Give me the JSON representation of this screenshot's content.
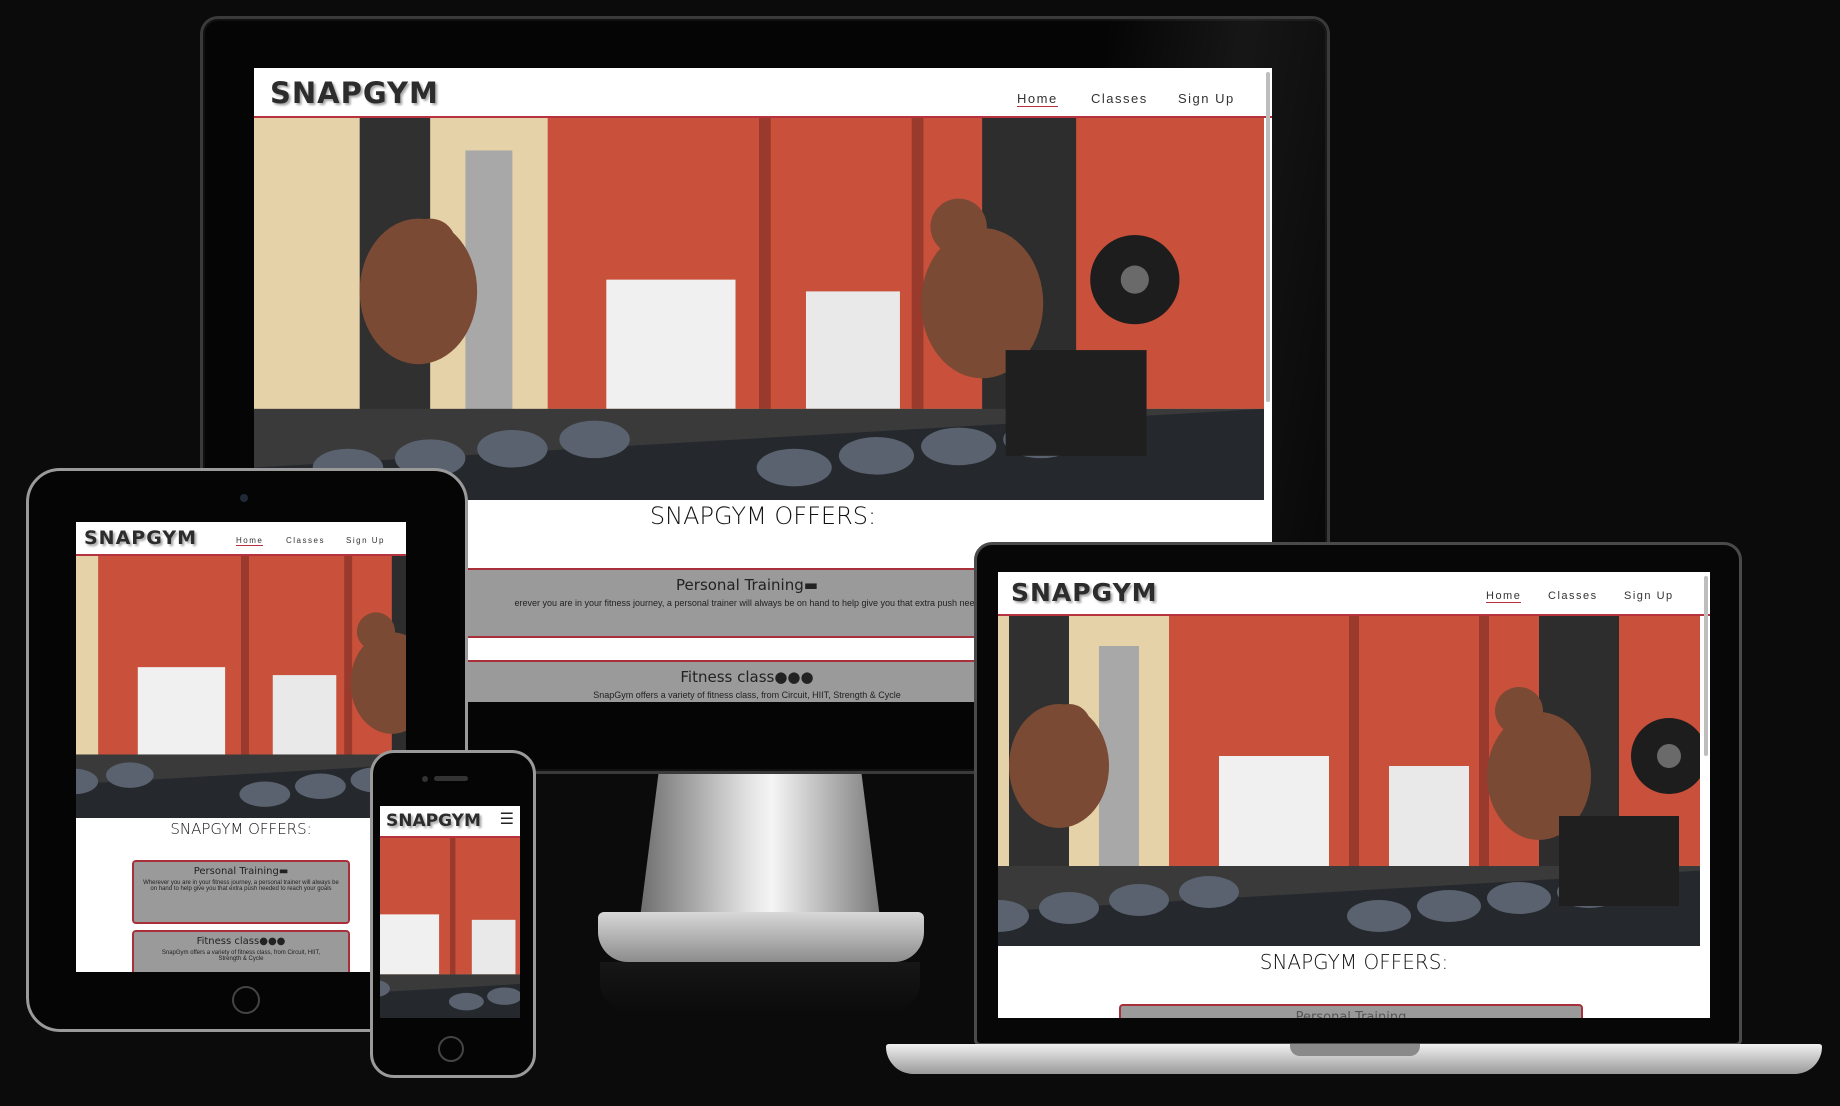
{
  "site": {
    "brand": "SNAPGYM"
  },
  "nav": {
    "home": "Home",
    "classes": "Classes",
    "signup": "Sign Up"
  },
  "offers": {
    "title": "SNAPGYM OFFERS:",
    "cards": [
      {
        "title": "Personal Training",
        "icon": "dumbbell-icon",
        "text": "Wherever you are in your fitness journey, a personal trainer will always be on hand to help give you that extra push needed to reach your goals"
      },
      {
        "title": "Fitness class",
        "icon": "people-group-icon",
        "text": "SnapGym offers a variety of fitness class, from Circuit, HIIT, Strength & Cycle"
      }
    ],
    "desktop_card1_text": "erever you are in your fitness journey, a personal trainer will always be on hand to help give you that extra push need",
    "desktop_card2_text": "SnapGym offers a variety of fitness class, from Circuit, HIIT, Strength & Cycle",
    "laptop_card_partial": "Personal Training"
  },
  "colors": {
    "accent": "#b7323f",
    "card": "#9a9a9a",
    "wall": "#c9503a"
  }
}
